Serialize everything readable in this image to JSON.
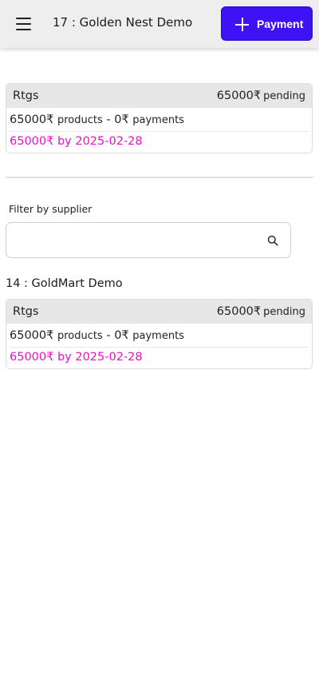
{
  "header": {
    "title": "17 : Golden Nest Demo",
    "menu_icon": "hamburger-menu-icon",
    "payment_button": {
      "icon": "plus-icon",
      "label": "Payment"
    }
  },
  "summary_card": {
    "method": "Rtgs",
    "amount": "65000₹",
    "status": "pending",
    "products_amount": "65000₹",
    "products_label": "products",
    "separator": "-",
    "payments_amount": "0₹",
    "payments_label": "payments",
    "due_text": "65000₹ by 2025-02-28"
  },
  "filter": {
    "label": "Filter by supplier",
    "value": "",
    "placeholder": "",
    "search_icon": "search-icon"
  },
  "suppliers": [
    {
      "heading": "14 : GoldMart Demo",
      "card": {
        "method": "Rtgs",
        "amount": "65000₹",
        "status": "pending",
        "products_amount": "65000₹",
        "products_label": "products",
        "separator": "-",
        "payments_amount": "0₹",
        "payments_label": "payments",
        "due_text": "65000₹ by 2025-02-28"
      }
    }
  ],
  "colors": {
    "header_bg": "#eeeeee",
    "accent": "#3d12f5",
    "due_text": "#ee10c8",
    "card_head_bg": "#e7e7e7"
  }
}
